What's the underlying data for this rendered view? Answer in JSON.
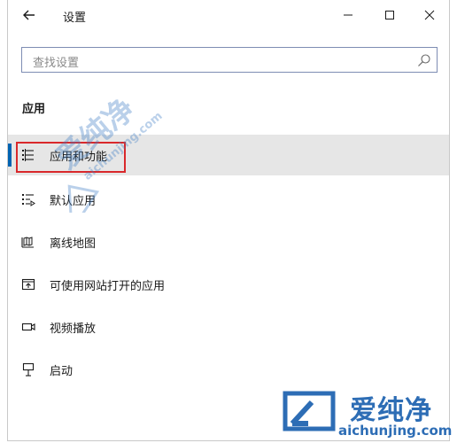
{
  "window": {
    "title": "设置"
  },
  "search": {
    "placeholder": "查找设置"
  },
  "section": {
    "heading": "应用"
  },
  "nav": {
    "items": [
      {
        "label": "应用和功能",
        "icon": "apps-features-icon",
        "selected": true
      },
      {
        "label": "默认应用",
        "icon": "default-apps-icon",
        "selected": false
      },
      {
        "label": "离线地图",
        "icon": "offline-maps-icon",
        "selected": false
      },
      {
        "label": "可使用网站打开的应用",
        "icon": "apps-for-websites-icon",
        "selected": false
      },
      {
        "label": "视频播放",
        "icon": "video-playback-icon",
        "selected": false
      },
      {
        "label": "启动",
        "icon": "startup-icon",
        "selected": false
      }
    ]
  },
  "watermark": {
    "brand": "爱纯净",
    "url": "aichunjing.com"
  },
  "colors": {
    "accent": "#0063b1",
    "selected_bg": "#e6e6e6",
    "highlight": "#d9282b",
    "watermark": "#2d6db5"
  }
}
